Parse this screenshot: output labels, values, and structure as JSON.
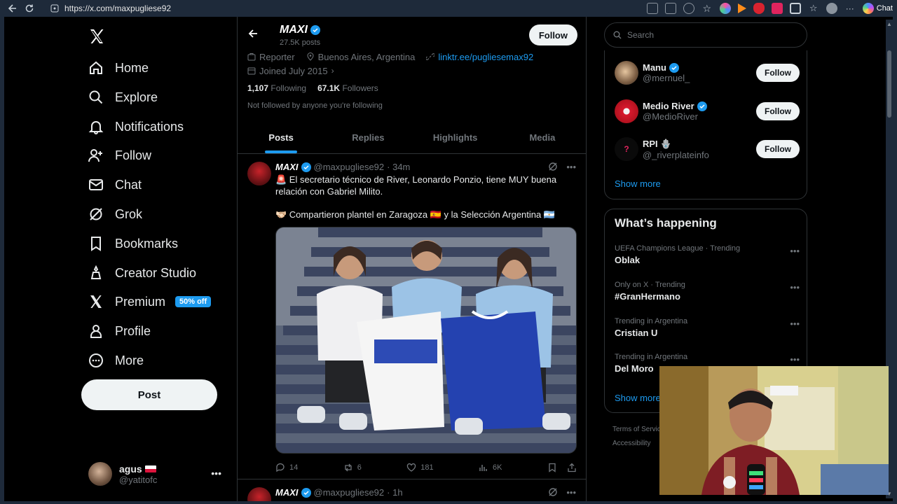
{
  "browser": {
    "url": "https://x.com/maxpugliese92",
    "chat_label": "Chat"
  },
  "nav": {
    "items": [
      {
        "label": "Home"
      },
      {
        "label": "Explore"
      },
      {
        "label": "Notifications"
      },
      {
        "label": "Follow"
      },
      {
        "label": "Chat"
      },
      {
        "label": "Grok"
      },
      {
        "label": "Bookmarks"
      },
      {
        "label": "Creator Studio"
      },
      {
        "label": "Premium",
        "badge": "50% off"
      },
      {
        "label": "Profile"
      },
      {
        "label": "More"
      }
    ],
    "post_label": "Post"
  },
  "account": {
    "name": "agus",
    "handle": "@yatitofc"
  },
  "profile": {
    "name": "MAXI",
    "posts_count": "27.5K posts",
    "follow_label": "Follow",
    "role": "Reporter",
    "location": "Buenos Aires, Argentina",
    "link": "linktr.ee/pugliesemax92",
    "joined": "Joined July 2015",
    "following_count": "1,107",
    "following_label": "Following",
    "followers_count": "67.1K",
    "followers_label": "Followers",
    "not_followed": "Not followed by anyone you're following",
    "tabs": [
      "Posts",
      "Replies",
      "Highlights",
      "Media"
    ]
  },
  "tweets": [
    {
      "name": "MAXI",
      "handle": "@maxpugliese92",
      "time": "· 34m",
      "line1": "🚨 El secretario técnico de River, Leonardo Ponzio, tiene MUY buena relación con Gabriel Milito.",
      "line2": "🫱🏻‍🫲🏼 Compartieron plantel en Zaragoza 🇪🇸 y la Selección Argentina 🇦🇷",
      "replies": "14",
      "reposts": "6",
      "likes": "181",
      "views": "6K"
    },
    {
      "name": "MAXI",
      "handle": "@maxpugliese92",
      "time": "· 1h"
    }
  ],
  "search": {
    "placeholder": "Search"
  },
  "who_to_follow": {
    "accounts": [
      {
        "name": "Manu",
        "handle": "@mernuel_",
        "verified": true
      },
      {
        "name": "Medio River",
        "handle": "@MedioRiver",
        "verified": true
      },
      {
        "name": "RPI 🪬",
        "handle": "@_riverplateinfo",
        "verified": false
      }
    ],
    "follow_label": "Follow",
    "show_more": "Show more"
  },
  "happening": {
    "title": "What’s happening",
    "trends": [
      {
        "context": "UEFA Champions League · Trending",
        "topic": "Oblak"
      },
      {
        "context": "Only on X · Trending",
        "topic": "#GranHermano"
      },
      {
        "context": "Trending in Argentina",
        "topic": "Cristian U"
      },
      {
        "context": "Trending in Argentina",
        "topic": "Del Moro"
      }
    ],
    "show_more": "Show more"
  },
  "footer": {
    "terms": "Terms of Servic",
    "accessibility": "Accessibility"
  }
}
